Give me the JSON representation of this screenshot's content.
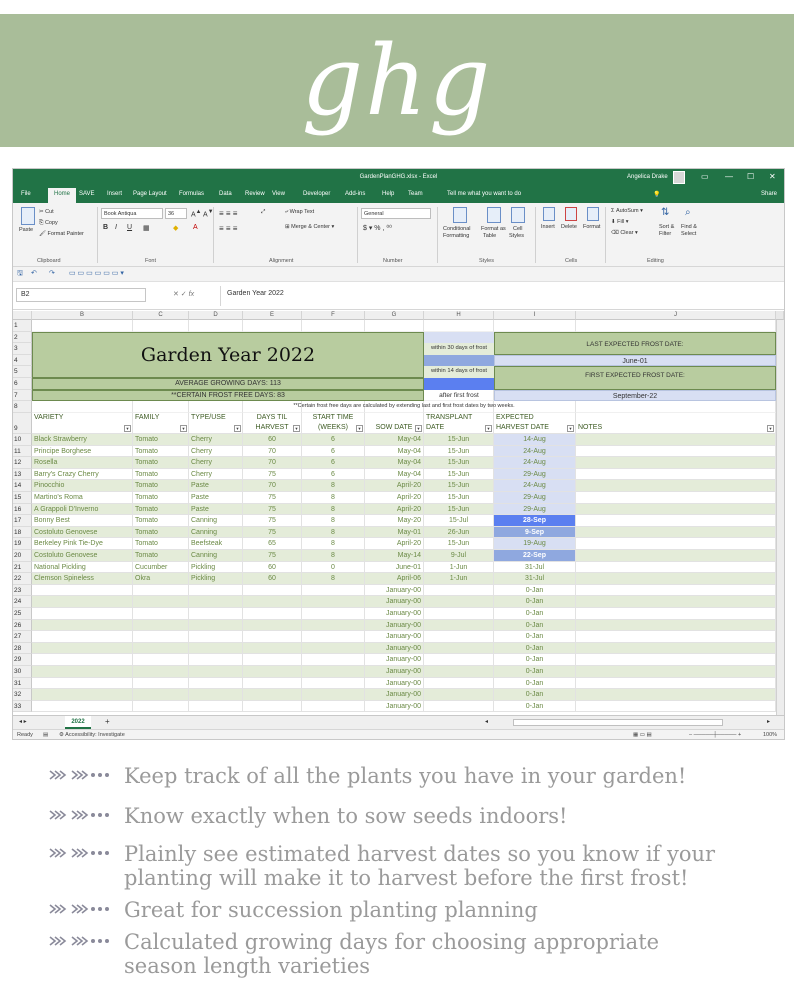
{
  "logo": "ghg",
  "window": {
    "title": "GardenPlanGHG.xlsx  -  Excel",
    "user": "Angelica Drake",
    "controls": [
      "▭",
      "—",
      "☐",
      "✕"
    ]
  },
  "menu": {
    "items": [
      "File",
      "Home",
      "SAVE",
      "Insert",
      "Page Layout",
      "Formulas",
      "Data",
      "Review",
      "View",
      "Developer",
      "Add-ins",
      "Help",
      "Team"
    ],
    "tell": "Tell me what you want to do",
    "share": "Share"
  },
  "ribbon": {
    "paste": "Paste",
    "cut": "Cut",
    "copy": "Copy",
    "format_painter": "Format Painter",
    "clipboard": "Clipboard",
    "font_name": "Book Antiqua",
    "font_size": "36",
    "font_group": "Font",
    "wrap_text": "Wrap Text",
    "merge_center": "Merge & Center",
    "alignment": "Alignment",
    "number_format": "General",
    "number_group": "Number",
    "conditional": "Conditional",
    "conditional2": "Formatting",
    "format_table": "Format as",
    "format_table2": "Table",
    "cell_styles": "Cell",
    "cell_styles2": "Styles",
    "styles_group": "Styles",
    "insert": "Insert",
    "delete": "Delete",
    "format": "Format",
    "cells_group": "Cells",
    "autosum": "AutoSum",
    "fill": "Fill",
    "clear": "Clear",
    "sort": "Sort &",
    "sort2": "Filter",
    "find": "Find &",
    "find2": "Select",
    "editing_group": "Editing"
  },
  "formula_bar": {
    "name_box": "B2",
    "fx": "fx",
    "value": "Garden Year 2022"
  },
  "columns": [
    "B",
    "C",
    "D",
    "E",
    "F",
    "G",
    "H",
    "I",
    "J"
  ],
  "sheet": {
    "title": "Garden Year 2022",
    "avg_days": "AVERAGE GROWING DAYS: 113",
    "frost_free": "**CERTAIN FROST FREE DAYS: 83",
    "note": "**Certain frost free days are calculated by extending last and first frost dates by two weeks.",
    "within30": "within 30 days of frost",
    "within14": "within 14 days of frost",
    "after_first": "after first frost",
    "last_frost_label": "LAST EXPECTED FROST DATE:",
    "last_frost_value": "June-01",
    "first_frost_label": "FIRST EXPECTED FROST DATE:",
    "first_frost_value": "September-22",
    "headers": {
      "variety": "VARIETY",
      "family": "FAMILY",
      "type": "TYPE/USE",
      "days1": "DAYS TIL",
      "days2": "HARVEST",
      "start1": "START TIME",
      "start2": "(WEEKS)",
      "sow": "SOW DATE",
      "tp1": "TRANSPLANT",
      "tp2": "DATE",
      "exp1": "EXPECTED",
      "exp2": "HARVEST DATE",
      "notes": "NOTES"
    },
    "rows": [
      {
        "n": "10",
        "variety": "Black Strawberry",
        "family": "Tomato",
        "type": "Cherry",
        "days": "60",
        "weeks": "6",
        "sow": "May-04",
        "tp": "15-Jun",
        "harvest": "14-Aug",
        "hl": "light"
      },
      {
        "n": "11",
        "variety": "Principe Borghese",
        "family": "Tomato",
        "type": "Cherry",
        "days": "70",
        "weeks": "6",
        "sow": "May-04",
        "tp": "15-Jun",
        "harvest": "24-Aug",
        "hl": "light"
      },
      {
        "n": "12",
        "variety": "Rosella",
        "family": "Tomato",
        "type": "Cherry",
        "days": "70",
        "weeks": "6",
        "sow": "May-04",
        "tp": "15-Jun",
        "harvest": "24-Aug",
        "hl": "light"
      },
      {
        "n": "13",
        "variety": "Barry's Crazy Cherry",
        "family": "Tomato",
        "type": "Cherry",
        "days": "75",
        "weeks": "6",
        "sow": "May-04",
        "tp": "15-Jun",
        "harvest": "29-Aug",
        "hl": "light"
      },
      {
        "n": "14",
        "variety": "Pinocchio",
        "family": "Tomato",
        "type": "Paste",
        "days": "70",
        "weeks": "8",
        "sow": "April-20",
        "tp": "15-Jun",
        "harvest": "24-Aug",
        "hl": "light"
      },
      {
        "n": "15",
        "variety": "Martino's Roma",
        "family": "Tomato",
        "type": "Paste",
        "days": "75",
        "weeks": "8",
        "sow": "April-20",
        "tp": "15-Jun",
        "harvest": "29-Aug",
        "hl": "light"
      },
      {
        "n": "16",
        "variety": "A Grappoli D'Inverno",
        "family": "Tomato",
        "type": "Paste",
        "days": "75",
        "weeks": "8",
        "sow": "April-20",
        "tp": "15-Jun",
        "harvest": "29-Aug",
        "hl": "light"
      },
      {
        "n": "17",
        "variety": "Bonny Best",
        "family": "Tomato",
        "type": "Canning",
        "days": "75",
        "weeks": "8",
        "sow": "May-20",
        "tp": "15-Jul",
        "harvest": "28-Sep",
        "hl": "dark"
      },
      {
        "n": "18",
        "variety": "Costoluto Genovese",
        "family": "Tomato",
        "type": "Canning",
        "days": "75",
        "weeks": "8",
        "sow": "May-01",
        "tp": "26-Jun",
        "harvest": "9-Sep",
        "hl": "mid"
      },
      {
        "n": "19",
        "variety": "Berkeley Pink Tie-Dye",
        "family": "Tomato",
        "type": "Beefsteak",
        "days": "65",
        "weeks": "8",
        "sow": "April-20",
        "tp": "15-Jun",
        "harvest": "19-Aug",
        "hl": "light"
      },
      {
        "n": "20",
        "variety": "Costoluto Genovese",
        "family": "Tomato",
        "type": "Canning",
        "days": "75",
        "weeks": "8",
        "sow": "May-14",
        "tp": "9-Jul",
        "harvest": "22-Sep",
        "hl": "mid"
      },
      {
        "n": "21",
        "variety": "National Pickling",
        "family": "Cucumber",
        "type": "Pickling",
        "days": "60",
        "weeks": "0",
        "sow": "June-01",
        "tp": "1-Jun",
        "harvest": "31-Jul",
        "hl": "none"
      },
      {
        "n": "22",
        "variety": "Clemson Spineless",
        "family": "Okra",
        "type": "Pickling",
        "days": "60",
        "weeks": "8",
        "sow": "April-06",
        "tp": "1-Jun",
        "harvest": "31-Jul",
        "hl": "none"
      },
      {
        "n": "23",
        "variety": "",
        "family": "",
        "type": "",
        "days": "",
        "weeks": "",
        "sow": "January-00",
        "tp": "",
        "harvest": "0-Jan",
        "hl": "none"
      },
      {
        "n": "24",
        "variety": "",
        "family": "",
        "type": "",
        "days": "",
        "weeks": "",
        "sow": "January-00",
        "tp": "",
        "harvest": "0-Jan",
        "hl": "none"
      },
      {
        "n": "25",
        "variety": "",
        "family": "",
        "type": "",
        "days": "",
        "weeks": "",
        "sow": "January-00",
        "tp": "",
        "harvest": "0-Jan",
        "hl": "none"
      },
      {
        "n": "26",
        "variety": "",
        "family": "",
        "type": "",
        "days": "",
        "weeks": "",
        "sow": "January-00",
        "tp": "",
        "harvest": "0-Jan",
        "hl": "none"
      },
      {
        "n": "27",
        "variety": "",
        "family": "",
        "type": "",
        "days": "",
        "weeks": "",
        "sow": "January-00",
        "tp": "",
        "harvest": "0-Jan",
        "hl": "none"
      },
      {
        "n": "28",
        "variety": "",
        "family": "",
        "type": "",
        "days": "",
        "weeks": "",
        "sow": "January-00",
        "tp": "",
        "harvest": "0-Jan",
        "hl": "none"
      },
      {
        "n": "29",
        "variety": "",
        "family": "",
        "type": "",
        "days": "",
        "weeks": "",
        "sow": "January-00",
        "tp": "",
        "harvest": "0-Jan",
        "hl": "none"
      },
      {
        "n": "30",
        "variety": "",
        "family": "",
        "type": "",
        "days": "",
        "weeks": "",
        "sow": "January-00",
        "tp": "",
        "harvest": "0-Jan",
        "hl": "none"
      },
      {
        "n": "31",
        "variety": "",
        "family": "",
        "type": "",
        "days": "",
        "weeks": "",
        "sow": "January-00",
        "tp": "",
        "harvest": "0-Jan",
        "hl": "none"
      },
      {
        "n": "32",
        "variety": "",
        "family": "",
        "type": "",
        "days": "",
        "weeks": "",
        "sow": "January-00",
        "tp": "",
        "harvest": "0-Jan",
        "hl": "none"
      },
      {
        "n": "33",
        "variety": "",
        "family": "",
        "type": "",
        "days": "",
        "weeks": "",
        "sow": "January-00",
        "tp": "",
        "harvest": "0-Jan",
        "hl": "none"
      }
    ]
  },
  "tabs": {
    "sheet": "2022",
    "add": "+"
  },
  "status": {
    "ready": "Ready",
    "accessibility": "Accessibility: Investigate",
    "zoom": "100%"
  },
  "colors": {
    "banner": "#a9bd99",
    "excel_green": "#217346",
    "stripe": "#e4ecd9",
    "light_blue": "#d8dff3",
    "mid_blue": "#8fa8df",
    "dark_blue": "#5b7ff0"
  },
  "bullets": [
    {
      "lines": [
        "Keep track of all the plants you have in your garden!"
      ]
    },
    {
      "lines": [
        "Know exactly when to sow seeds indoors!"
      ]
    },
    {
      "lines": [
        "Plainly see estimated harvest dates so you know if your",
        "planting will make it to harvest before the first frost!"
      ]
    },
    {
      "lines": [
        "Great for succession planting planning"
      ]
    },
    {
      "lines": [
        "Calculated growing days for choosing appropriate",
        "season length varieties"
      ]
    }
  ]
}
